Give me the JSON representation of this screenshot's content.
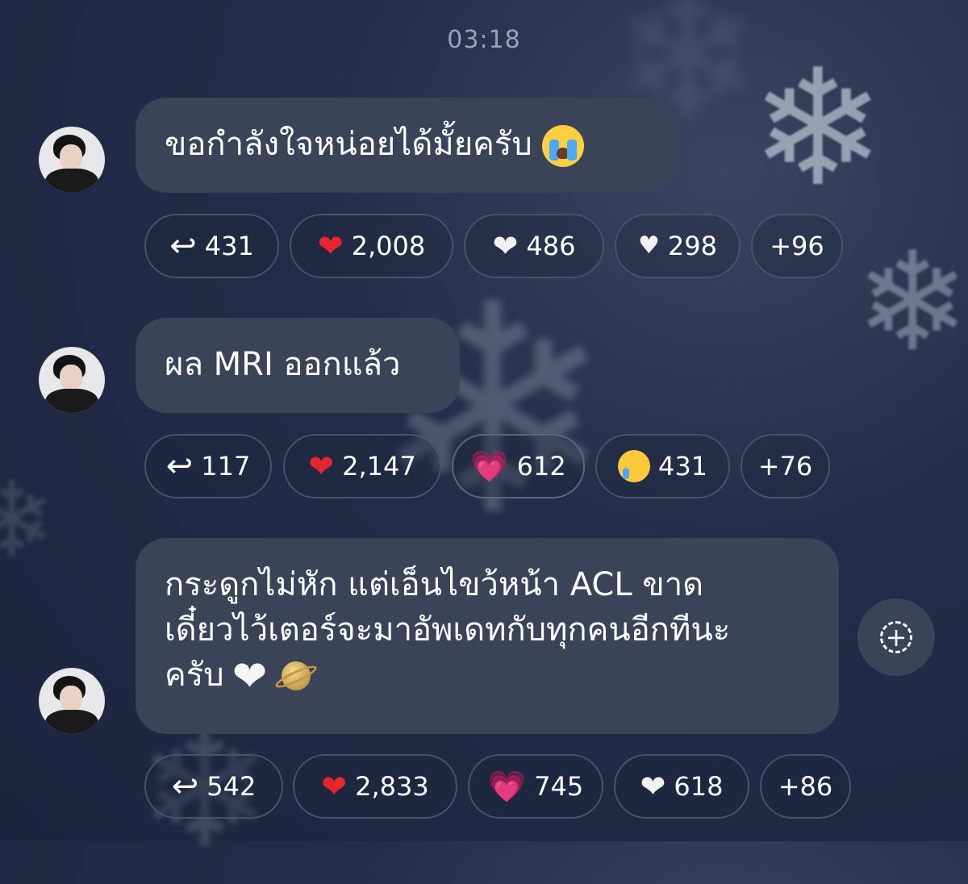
{
  "timestamp": "03:18",
  "messages": [
    {
      "text": "ขอกำลังใจหน่อยได้มั้ยครับ",
      "trailing_emoji": "loudly-crying-face",
      "reactions": [
        {
          "icon": "reply-arrow",
          "count": "431"
        },
        {
          "icon": "red-heart",
          "count": "2,008"
        },
        {
          "icon": "white-heart",
          "count": "486"
        },
        {
          "icon": "small-white-heart",
          "count": "298"
        },
        {
          "icon": "",
          "count": "+96"
        }
      ]
    },
    {
      "text": "ผล MRI ออกแล้ว",
      "reactions": [
        {
          "icon": "reply-arrow",
          "count": "117"
        },
        {
          "icon": "red-heart",
          "count": "2,147"
        },
        {
          "icon": "sparkling-pink-heart",
          "count": "612"
        },
        {
          "icon": "crying-face",
          "count": "431"
        },
        {
          "icon": "",
          "count": "+76"
        }
      ]
    },
    {
      "lines": [
        "กระดูกไม่หัก แต่เอ็นไขว้หน้า ACL ขาด",
        "เดี๋ยวไว้เตอร์จะมาอัพเดทกับทุกคนอีกทีนะ",
        "ครับ"
      ],
      "trailing_emoji": [
        "white-heart",
        "ringed-planet"
      ],
      "reactions": [
        {
          "icon": "reply-arrow",
          "count": "542"
        },
        {
          "icon": "red-heart",
          "count": "2,833"
        },
        {
          "icon": "sparkling-pink-heart",
          "count": "745"
        },
        {
          "icon": "white-heart",
          "count": "618"
        },
        {
          "icon": "",
          "count": "+86"
        }
      ]
    }
  ],
  "add_reaction_icon": "add-reaction-icon",
  "colors": {
    "background": "#1f2744",
    "bubble": "#3b4358",
    "pill_border": "#4a5268",
    "timestamp": "#9aa3b8",
    "red_heart": "#e8252e"
  }
}
